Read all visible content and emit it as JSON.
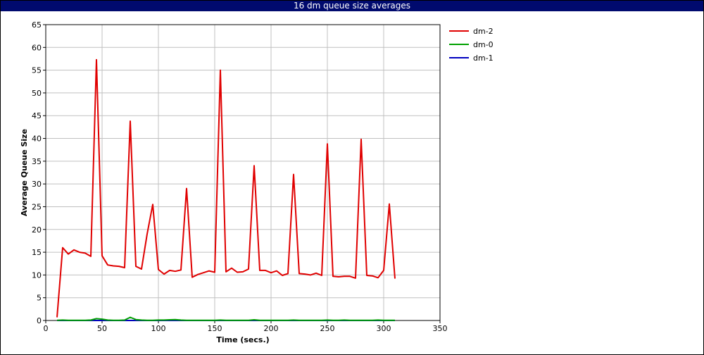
{
  "window": {
    "title": "16 dm queue size averages",
    "title_bar_color": "#000a6e"
  },
  "chart_data": {
    "type": "line",
    "title": "16 dm queue size averages",
    "xlabel": "Time (secs.)",
    "ylabel": "Average Queue Size",
    "xlim": [
      0,
      350
    ],
    "ylim": [
      0,
      65
    ],
    "xticks": [
      0,
      50,
      100,
      150,
      200,
      250,
      300,
      350
    ],
    "yticks": [
      0,
      5,
      10,
      15,
      20,
      25,
      30,
      35,
      40,
      45,
      50,
      55,
      60,
      65
    ],
    "grid": true,
    "legend_position": "top-right",
    "series": [
      {
        "name": "dm-2",
        "color": "#e00000",
        "x": [
          10,
          15,
          20,
          25,
          30,
          35,
          40,
          45,
          50,
          55,
          60,
          65,
          70,
          75,
          80,
          85,
          90,
          95,
          100,
          105,
          110,
          115,
          120,
          125,
          130,
          135,
          140,
          145,
          150,
          155,
          160,
          165,
          170,
          175,
          180,
          185,
          190,
          195,
          200,
          205,
          210,
          215,
          220,
          225,
          230,
          235,
          240,
          245,
          250,
          255,
          260,
          265,
          270,
          275,
          280,
          285,
          290,
          295,
          300,
          305,
          310
        ],
        "y": [
          0.7,
          16.0,
          14.6,
          15.5,
          15.0,
          14.8,
          14.1,
          57.3,
          14.2,
          12.2,
          12.0,
          11.9,
          11.6,
          43.8,
          11.9,
          11.3,
          19.0,
          25.5,
          11.2,
          10.2,
          11.0,
          10.8,
          11.1,
          29.0,
          9.5,
          10.1,
          10.5,
          10.9,
          10.6,
          55.0,
          10.7,
          11.5,
          10.6,
          10.7,
          11.3,
          34.0,
          11.0,
          11.0,
          10.5,
          10.9,
          9.9,
          10.3,
          32.1,
          10.3,
          10.2,
          10.0,
          10.4,
          9.9,
          38.8,
          9.7,
          9.6,
          9.7,
          9.7,
          9.3,
          39.8,
          9.9,
          9.8,
          9.4,
          11.0,
          25.6,
          9.2
        ]
      },
      {
        "name": "dm-0",
        "color": "#00a000",
        "x": [
          10,
          15,
          20,
          25,
          30,
          35,
          40,
          45,
          50,
          55,
          60,
          65,
          70,
          75,
          80,
          85,
          90,
          95,
          100,
          105,
          110,
          115,
          120,
          125,
          130,
          135,
          140,
          145,
          150,
          155,
          160,
          165,
          170,
          175,
          180,
          185,
          190,
          195,
          200,
          205,
          210,
          215,
          220,
          225,
          230,
          235,
          240,
          245,
          250,
          255,
          260,
          265,
          270,
          275,
          280,
          285,
          290,
          295,
          300,
          305,
          310
        ],
        "y": [
          0.05,
          0.1,
          0.05,
          0.05,
          0.05,
          0.05,
          0.1,
          0.4,
          0.3,
          0.1,
          0.05,
          0.05,
          0.1,
          0.7,
          0.2,
          0.1,
          0.05,
          0.05,
          0.1,
          0.1,
          0.15,
          0.2,
          0.1,
          0.05,
          0.05,
          0.05,
          0.05,
          0.05,
          0.05,
          0.1,
          0.05,
          0.05,
          0.05,
          0.05,
          0.05,
          0.15,
          0.05,
          0.05,
          0.05,
          0.05,
          0.05,
          0.05,
          0.1,
          0.05,
          0.05,
          0.05,
          0.05,
          0.05,
          0.1,
          0.05,
          0.05,
          0.1,
          0.05,
          0.05,
          0.05,
          0.05,
          0.05,
          0.1,
          0.05,
          0.05,
          0.05
        ]
      },
      {
        "name": "dm-1",
        "color": "#0000c0",
        "x": [
          10,
          310
        ],
        "y": [
          0,
          0
        ]
      }
    ]
  }
}
